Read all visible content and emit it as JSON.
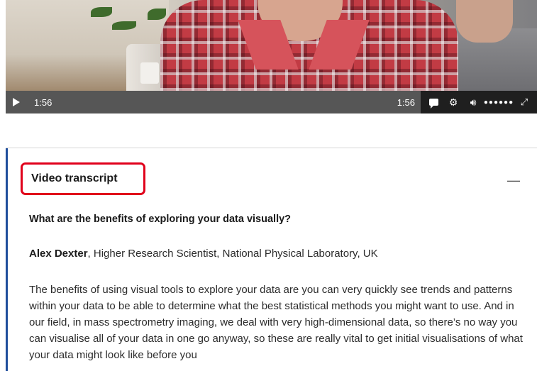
{
  "video": {
    "current_time": "1:56",
    "duration": "1:56",
    "icons": [
      "play-icon",
      "captions-icon",
      "settings-icon",
      "volume-icon",
      "volume-level-dots",
      "fullscreen-icon"
    ],
    "volume_dots": "●●●●●●"
  },
  "transcript": {
    "title": "Video transcript",
    "collapse_symbol": "—",
    "question": "What are the benefits of exploring your data visually?",
    "speaker_name": "Alex Dexter",
    "speaker_role": ", Higher Research Scientist, National Physical Laboratory, UK",
    "paragraph": "The benefits of using visual tools to explore your data are you can very quickly see trends and patterns within your data to be able to determine what the best statistical methods you might want to use. And in our field, in mass spectrometry imaging, we deal with very high-dimensional data, so there’s no way you can visualise all of your data in one go anyway, so these are really vital to get initial visualisations of what your data might look like before you"
  },
  "colors": {
    "highlight_box": "#e0001b",
    "panel_accent": "#1f4e9c",
    "control_bar": "#565656"
  }
}
